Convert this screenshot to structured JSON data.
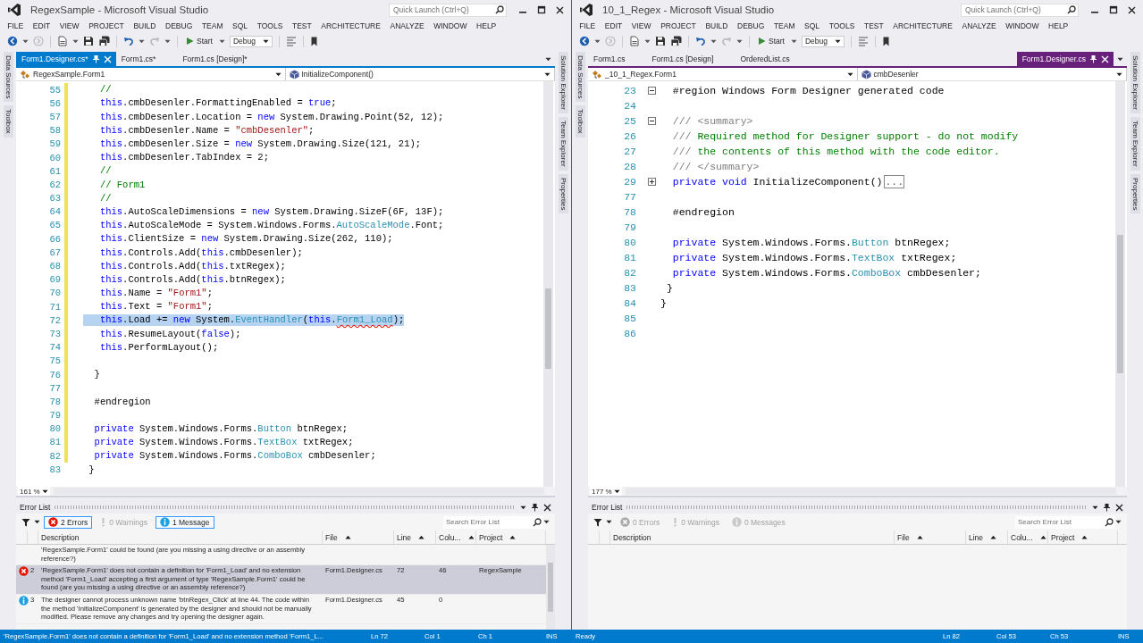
{
  "windows": [
    {
      "title": "RegexSample - Microsoft Visual Studio",
      "color": "#007acc",
      "quick_launch": {
        "placeholder": "Quick Launch (Ctrl+Q)"
      },
      "menu": [
        "FILE",
        "EDIT",
        "VIEW",
        "PROJECT",
        "BUILD",
        "DEBUG",
        "TEAM",
        "SQL",
        "TOOLS",
        "TEST",
        "ARCHITECTURE",
        "ANALYZE",
        "WINDOW",
        "HELP"
      ],
      "toolbar": {
        "start": "Start",
        "configuration": "Debug"
      },
      "left_dock": [
        "Data Sources",
        "Toolbox"
      ],
      "right_dock": [
        "Solution Explorer",
        "Team Explorer",
        "Properties"
      ],
      "tabs": [
        {
          "label": "Form1.Designer.cs*",
          "selected": true
        },
        {
          "label": "Form1.cs*",
          "selected": false
        },
        {
          "label": "Form1.cs [Design]*",
          "selected": false
        }
      ],
      "nav": {
        "type": "RegexSample.Form1",
        "member": "InitializeComponent()"
      },
      "editor": {
        "lines": [
          {
            "number": "55",
            "changed": true,
            "selected": false,
            "tokens": [
              {
                "kind": "comment",
                "text": "   //"
              }
            ]
          },
          {
            "number": "56",
            "changed": true,
            "selected": false,
            "tokens": [
              {
                "kind": "keyword",
                "text": "   this"
              },
              {
                "kind": "plain",
                "text": ".cmbDesenler.FormattingEnabled = "
              },
              {
                "kind": "keyword",
                "text": "true"
              },
              {
                "kind": "plain",
                "text": ";"
              }
            ]
          },
          {
            "number": "57",
            "changed": true,
            "selected": false,
            "tokens": [
              {
                "kind": "keyword",
                "text": "   this"
              },
              {
                "kind": "plain",
                "text": ".cmbDesenler.Location = "
              },
              {
                "kind": "keyword",
                "text": "new"
              },
              {
                "kind": "plain",
                "text": " System.Drawing.Point(52, 12);"
              }
            ]
          },
          {
            "number": "58",
            "changed": true,
            "selected": false,
            "tokens": [
              {
                "kind": "keyword",
                "text": "   this"
              },
              {
                "kind": "plain",
                "text": ".cmbDesenler.Name = "
              },
              {
                "kind": "string",
                "text": "\"cmbDesenler\""
              },
              {
                "kind": "plain",
                "text": ";"
              }
            ]
          },
          {
            "number": "59",
            "changed": true,
            "selected": false,
            "tokens": [
              {
                "kind": "keyword",
                "text": "   this"
              },
              {
                "kind": "plain",
                "text": ".cmbDesenler.Size = "
              },
              {
                "kind": "keyword",
                "text": "new"
              },
              {
                "kind": "plain",
                "text": " System.Drawing.Size(121, 21);"
              }
            ]
          },
          {
            "number": "60",
            "changed": true,
            "selected": false,
            "tokens": [
              {
                "kind": "keyword",
                "text": "   this"
              },
              {
                "kind": "plain",
                "text": ".cmbDesenler.TabIndex = 2;"
              }
            ]
          },
          {
            "number": "61",
            "changed": true,
            "selected": false,
            "tokens": [
              {
                "kind": "comment",
                "text": "   //"
              }
            ]
          },
          {
            "number": "62",
            "changed": true,
            "selected": false,
            "tokens": [
              {
                "kind": "comment",
                "text": "   // Form1"
              }
            ]
          },
          {
            "number": "63",
            "changed": true,
            "selected": false,
            "tokens": [
              {
                "kind": "comment",
                "text": "   //"
              }
            ]
          },
          {
            "number": "64",
            "changed": true,
            "selected": false,
            "tokens": [
              {
                "kind": "keyword",
                "text": "   this"
              },
              {
                "kind": "plain",
                "text": ".AutoScaleDimensions = "
              },
              {
                "kind": "keyword",
                "text": "new"
              },
              {
                "kind": "plain",
                "text": " System.Drawing.SizeF(6F, 13F);"
              }
            ]
          },
          {
            "number": "65",
            "changed": true,
            "selected": false,
            "tokens": [
              {
                "kind": "keyword",
                "text": "   this"
              },
              {
                "kind": "plain",
                "text": ".AutoScaleMode = System.Windows.Forms."
              },
              {
                "kind": "type",
                "text": "AutoScaleMode"
              },
              {
                "kind": "plain",
                "text": ".Font;"
              }
            ]
          },
          {
            "number": "66",
            "changed": true,
            "selected": false,
            "tokens": [
              {
                "kind": "keyword",
                "text": "   this"
              },
              {
                "kind": "plain",
                "text": ".ClientSize = "
              },
              {
                "kind": "keyword",
                "text": "new"
              },
              {
                "kind": "plain",
                "text": " System.Drawing.Size(262, 110);"
              }
            ]
          },
          {
            "number": "67",
            "changed": true,
            "selected": false,
            "tokens": [
              {
                "kind": "keyword",
                "text": "   this"
              },
              {
                "kind": "plain",
                "text": ".Controls.Add("
              },
              {
                "kind": "keyword",
                "text": "this"
              },
              {
                "kind": "plain",
                "text": ".cmbDesenler);"
              }
            ]
          },
          {
            "number": "68",
            "changed": true,
            "selected": false,
            "tokens": [
              {
                "kind": "keyword",
                "text": "   this"
              },
              {
                "kind": "plain",
                "text": ".Controls.Add("
              },
              {
                "kind": "keyword",
                "text": "this"
              },
              {
                "kind": "plain",
                "text": ".txtRegex);"
              }
            ]
          },
          {
            "number": "69",
            "changed": true,
            "selected": false,
            "tokens": [
              {
                "kind": "keyword",
                "text": "   this"
              },
              {
                "kind": "plain",
                "text": ".Controls.Add("
              },
              {
                "kind": "keyword",
                "text": "this"
              },
              {
                "kind": "plain",
                "text": ".btnRegex);"
              }
            ]
          },
          {
            "number": "70",
            "changed": true,
            "selected": false,
            "tokens": [
              {
                "kind": "keyword",
                "text": "   this"
              },
              {
                "kind": "plain",
                "text": ".Name = "
              },
              {
                "kind": "string",
                "text": "\"Form1\""
              },
              {
                "kind": "plain",
                "text": ";"
              }
            ]
          },
          {
            "number": "71",
            "changed": true,
            "selected": false,
            "tokens": [
              {
                "kind": "keyword",
                "text": "   this"
              },
              {
                "kind": "plain",
                "text": ".Text = "
              },
              {
                "kind": "string",
                "text": "\"Form1\""
              },
              {
                "kind": "plain",
                "text": ";"
              }
            ]
          },
          {
            "number": "72",
            "changed": true,
            "selected": true,
            "tokens": [
              {
                "kind": "keyword",
                "text": "   this"
              },
              {
                "kind": "plain",
                "text": ".Load += "
              },
              {
                "kind": "keyword",
                "text": "new"
              },
              {
                "kind": "plain",
                "text": " System."
              },
              {
                "kind": "type",
                "text": "EventHandler"
              },
              {
                "kind": "plain",
                "text": "("
              },
              {
                "kind": "keyword",
                "text": "this"
              },
              {
                "kind": "plain",
                "text": "."
              },
              {
                "kind": "error",
                "text": "Form1_Load"
              },
              {
                "kind": "plain",
                "text": ");"
              }
            ]
          },
          {
            "number": "73",
            "changed": true,
            "selected": false,
            "tokens": [
              {
                "kind": "keyword",
                "text": "   this"
              },
              {
                "kind": "plain",
                "text": ".ResumeLayout("
              },
              {
                "kind": "keyword",
                "text": "false"
              },
              {
                "kind": "plain",
                "text": ");"
              }
            ]
          },
          {
            "number": "74",
            "changed": true,
            "selected": false,
            "tokens": [
              {
                "kind": "keyword",
                "text": "   this"
              },
              {
                "kind": "plain",
                "text": ".PerformLayout();"
              }
            ]
          },
          {
            "number": "75",
            "changed": true,
            "selected": false
          },
          {
            "number": "76",
            "changed": true,
            "selected": false,
            "tokens": [
              {
                "kind": "plain",
                "text": "  }"
              }
            ]
          },
          {
            "number": "77",
            "changed": true,
            "selected": false
          },
          {
            "number": "78",
            "changed": true,
            "selected": false,
            "tokens": [
              {
                "kind": "plain",
                "text": "  #endregion"
              }
            ]
          },
          {
            "number": "79",
            "changed": true,
            "selected": false
          },
          {
            "number": "80",
            "changed": true,
            "selected": false,
            "tokens": [
              {
                "kind": "keyword",
                "text": "  private"
              },
              {
                "kind": "plain",
                "text": " System.Windows.Forms."
              },
              {
                "kind": "type",
                "text": "Button"
              },
              {
                "kind": "plain",
                "text": " btnRegex;"
              }
            ]
          },
          {
            "number": "81",
            "changed": true,
            "selected": false,
            "tokens": [
              {
                "kind": "keyword",
                "text": "  private"
              },
              {
                "kind": "plain",
                "text": " System.Windows.Forms."
              },
              {
                "kind": "type",
                "text": "TextBox"
              },
              {
                "kind": "plain",
                "text": " txtRegex;"
              }
            ]
          },
          {
            "number": "82",
            "changed": true,
            "selected": false,
            "tokens": [
              {
                "kind": "keyword",
                "text": "  private"
              },
              {
                "kind": "plain",
                "text": " System.Windows.Forms."
              },
              {
                "kind": "type",
                "text": "ComboBox"
              },
              {
                "kind": "plain",
                "text": " cmbDesenler;"
              }
            ]
          },
          {
            "number": "83",
            "changed": false,
            "selected": false,
            "tokens": [
              {
                "kind": "plain",
                "text": " }"
              }
            ]
          }
        ]
      },
      "zoom": "161 %",
      "error_list": {
        "title": "Error List",
        "filters": [
          {
            "kind": "error",
            "label": "2 Errors",
            "selected": true,
            "disabled": false
          },
          {
            "kind": "warning",
            "label": "0 Warnings",
            "selected": false,
            "disabled": true
          },
          {
            "kind": "message",
            "label": "1 Message",
            "selected": true,
            "disabled": false
          }
        ],
        "search": {
          "placeholder": "Search Error List"
        },
        "columns": [
          {
            "label": "Description",
            "sorted": false
          },
          {
            "label": "File",
            "sorted": true
          },
          {
            "label": "Line",
            "sorted": true
          },
          {
            "label": "Colu...",
            "sorted": true
          },
          {
            "label": "Project",
            "sorted": true
          }
        ],
        "rows": [
          {
            "kind": "continued",
            "selected": false,
            "description": "'RegexSample.Form1' could be found (are you missing a using directive or an assembly reference?)"
          },
          {
            "kind": "error",
            "selected": true,
            "number": "2",
            "description": "'RegexSample.Form1' does not contain a definition for 'Form1_Load' and no extension method 'Form1_Load' accepting a first argument of type 'RegexSample.Form1' could be found (are you missing a using directive or an assembly reference?)",
            "file": "Form1.Designer.cs",
            "line": "72",
            "column": "46",
            "project": "RegexSample"
          },
          {
            "kind": "message",
            "selected": false,
            "number": "3",
            "description": "The designer cannot process unknown name 'btnRegex_Click' at line 44. The code within the method 'InitializeComponent' is generated by the designer and should not be manually modified. Please remove any changes and try opening the designer again.",
            "file": "Form1.Designer.cs",
            "line": "45",
            "column": "0"
          }
        ]
      },
      "status": {
        "message": "'RegexSample.Form1' does not contain a definition for 'Form1_Load' and no extension method 'Form1_L...",
        "line": "Ln 72",
        "column": "Col 1",
        "character": "Ch 1",
        "mode": "INS"
      }
    },
    {
      "title": "10_1_Regex - Microsoft Visual Studio",
      "color": "#68217a",
      "quick_launch": {
        "placeholder": "Quick Launch (Ctrl+Q)"
      },
      "menu": [
        "FILE",
        "EDIT",
        "VIEW",
        "PROJECT",
        "BUILD",
        "DEBUG",
        "TEAM",
        "SQL",
        "TOOLS",
        "TEST",
        "ARCHITECTURE",
        "ANALYZE",
        "WINDOW",
        "HELP"
      ],
      "toolbar": {
        "start": "Start",
        "configuration": "Debug"
      },
      "left_dock": [
        "Data Sources",
        "Toolbox"
      ],
      "right_dock": [
        "Solution Explorer",
        "Team Explorer",
        "Properties"
      ],
      "tabs": [
        {
          "label": "Form1.cs",
          "selected": false
        },
        {
          "label": "Form1.cs [Design]",
          "selected": false
        },
        {
          "label": "OrderedList.cs",
          "selected": false
        },
        {
          "label": "Form1.Designer.cs",
          "selected": true
        }
      ],
      "nav": {
        "type": "_10_1_Regex.Form1",
        "member": "cmbDesenler"
      },
      "editor": {
        "lines": [
          {
            "number": "23",
            "expanded": true,
            "tokens": [
              {
                "kind": "plain",
                "text": "  #region Windows Form Designer generated code"
              }
            ]
          },
          {
            "number": "24"
          },
          {
            "number": "25",
            "expanded": true,
            "tokens": [
              {
                "kind": "doc",
                "text": "  /// <summary>"
              }
            ]
          },
          {
            "number": "26",
            "tokens": [
              {
                "kind": "doc",
                "text": "  ///"
              },
              {
                "kind": "comment",
                "text": " Required method for Designer support - do not modify"
              }
            ]
          },
          {
            "number": "27",
            "tokens": [
              {
                "kind": "doc",
                "text": "  ///"
              },
              {
                "kind": "comment",
                "text": " the contents of this method with the code editor."
              }
            ]
          },
          {
            "number": "28",
            "tokens": [
              {
                "kind": "doc",
                "text": "  /// </summary>"
              }
            ]
          },
          {
            "number": "29",
            "expanded": false,
            "tokens": [
              {
                "kind": "keyword",
                "text": "  private void"
              },
              {
                "kind": "plain",
                "text": " InitializeComponent()"
              },
              {
                "kind": "collapsed",
                "text": "..."
              }
            ]
          },
          {
            "number": "77"
          },
          {
            "number": "78",
            "tokens": [
              {
                "kind": "plain",
                "text": "  #endregion"
              }
            ]
          },
          {
            "number": "79"
          },
          {
            "number": "80",
            "tokens": [
              {
                "kind": "keyword",
                "text": "  private"
              },
              {
                "kind": "plain",
                "text": " System.Windows.Forms."
              },
              {
                "kind": "type",
                "text": "Button"
              },
              {
                "kind": "plain",
                "text": " btnRegex;"
              }
            ]
          },
          {
            "number": "81",
            "tokens": [
              {
                "kind": "keyword",
                "text": "  private"
              },
              {
                "kind": "plain",
                "text": " System.Windows.Forms."
              },
              {
                "kind": "type",
                "text": "TextBox"
              },
              {
                "kind": "plain",
                "text": " txtRegex;"
              }
            ]
          },
          {
            "number": "82",
            "tokens": [
              {
                "kind": "keyword",
                "text": "  private"
              },
              {
                "kind": "plain",
                "text": " System.Windows.Forms."
              },
              {
                "kind": "type",
                "text": "ComboBox"
              },
              {
                "kind": "plain",
                "text": " cmbDesenler;"
              }
            ]
          },
          {
            "number": "83",
            "tokens": [
              {
                "kind": "plain",
                "text": " }"
              }
            ]
          },
          {
            "number": "84",
            "tokens": [
              {
                "kind": "plain",
                "text": "}"
              }
            ]
          },
          {
            "number": "85"
          },
          {
            "number": "86"
          }
        ]
      },
      "zoom": "177 %",
      "error_list": {
        "title": "Error List",
        "filters": [
          {
            "kind": "error",
            "label": "0 Errors",
            "selected": false,
            "disabled": true
          },
          {
            "kind": "warning",
            "label": "0 Warnings",
            "selected": false,
            "disabled": true
          },
          {
            "kind": "message",
            "label": "0 Messages",
            "selected": false,
            "disabled": true
          }
        ],
        "search": {
          "placeholder": "Search Error List"
        },
        "columns": [
          {
            "label": "Description",
            "sorted": false
          },
          {
            "label": "File",
            "sorted": true
          },
          {
            "label": "Line",
            "sorted": true
          },
          {
            "label": "Colu...",
            "sorted": true
          },
          {
            "label": "Project",
            "sorted": true
          }
        ]
      },
      "status": {
        "message": "Ready",
        "line": "Ln 82",
        "column": "Col 53",
        "character": "Ch 53",
        "mode": "INS"
      }
    }
  ]
}
